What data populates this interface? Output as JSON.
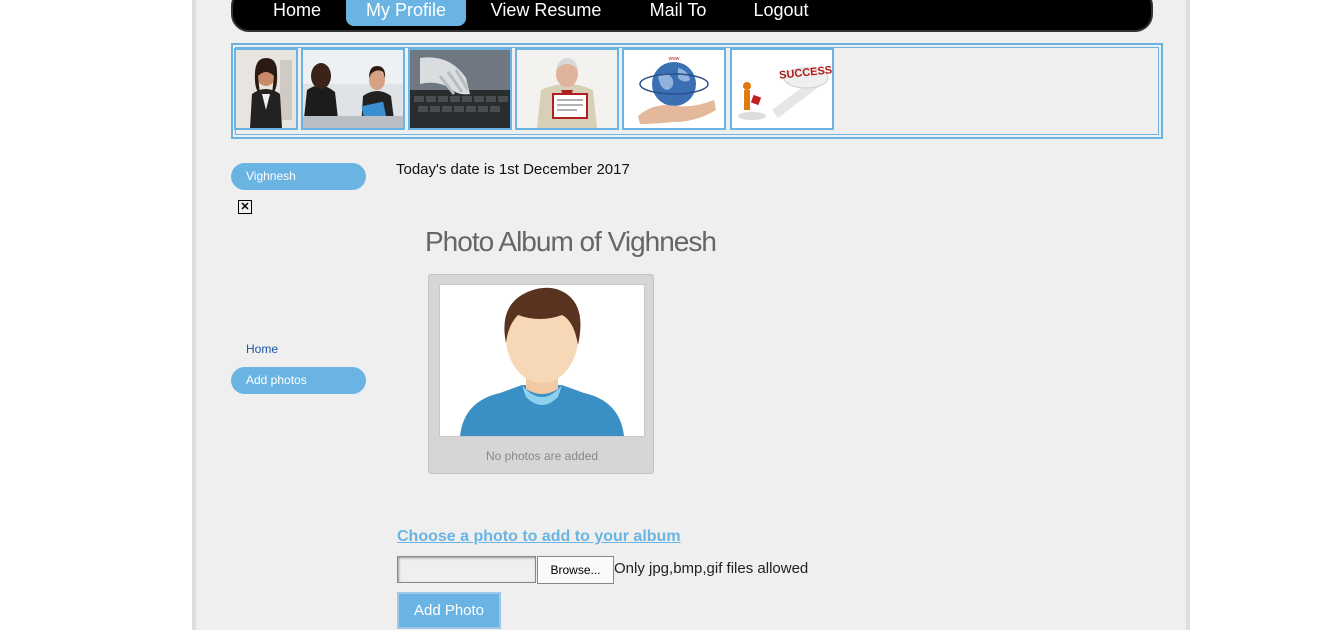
{
  "nav": {
    "items": [
      {
        "label": "Home",
        "active": false
      },
      {
        "label": "My Profile",
        "active": true
      },
      {
        "label": "View Resume",
        "active": false
      },
      {
        "label": "Mail To",
        "active": false
      },
      {
        "label": "Logout",
        "active": false
      }
    ]
  },
  "banner": {
    "images": [
      "businesswoman",
      "interview",
      "typing-hands",
      "man-with-certificate",
      "globe-in-hand",
      "success"
    ],
    "success_text": "SUCCESS"
  },
  "sidebar": {
    "user_name": "Vighnesh",
    "home_link": "Home",
    "add_photos": "Add photos",
    "broken_image_glyph": "✕"
  },
  "main": {
    "date_text": "Today's date is 1st December 2017",
    "album_title": "Photo Album of Vighnesh",
    "no_photos_text": "No photos are added",
    "choose_label": "Choose a photo to add to your album",
    "browse_label": "Browse...",
    "file_hint": "Only jpg,bmp,gif files allowed",
    "add_photo_label": "Add Photo"
  },
  "colors": {
    "accent": "#6ab4e4",
    "nav_bg": "#000000",
    "page_bg": "#efefef"
  }
}
